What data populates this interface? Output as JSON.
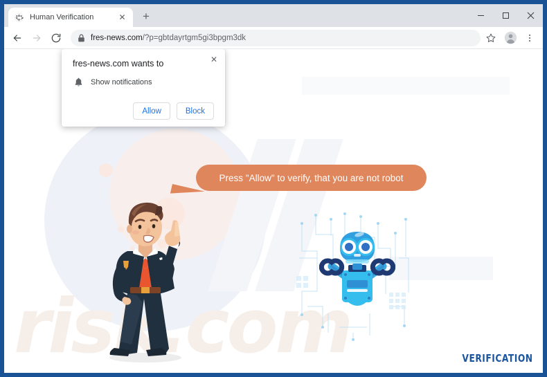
{
  "frame": {
    "border_color": "#1a5296"
  },
  "browser": {
    "tab": {
      "title": "Human Verification",
      "favicon": "globe-icon",
      "close_label": "✕"
    },
    "new_tab_label": "+",
    "window_controls": {
      "minimize": "–",
      "maximize": "□",
      "close": "✕"
    },
    "toolbar": {
      "back": "back-arrow-icon",
      "forward": "forward-arrow-icon",
      "reload": "reload-icon",
      "lock": "lock-icon",
      "url_domain": "fres-news.com",
      "url_path": "/?p=gbtdayrtgm5gi3bpgm3dk",
      "bookmark": "star-icon",
      "profile": "profile-avatar-icon",
      "menu": "three-dots-menu-icon"
    }
  },
  "permission_popup": {
    "title": "fres-news.com wants to",
    "permission_icon": "bell-icon",
    "permission_label": "Show notifications",
    "allow_label": "Allow",
    "block_label": "Block",
    "close_label": "✕",
    "accent_color": "#1a73e8"
  },
  "page": {
    "speech_bubble": {
      "text": "Press \"Allow\" to verify, that you are not robot",
      "color": "#e0865c",
      "text_color": "#ffffff"
    },
    "watermark_text": "risk.com",
    "footer_label": "VERIFICATION",
    "footer_color": "#1d56a0",
    "illustrations": {
      "man": "businessman-pointing-illustration",
      "robot": "robot-mascot-illustration",
      "circuit": "circuit-board-pattern"
    }
  }
}
